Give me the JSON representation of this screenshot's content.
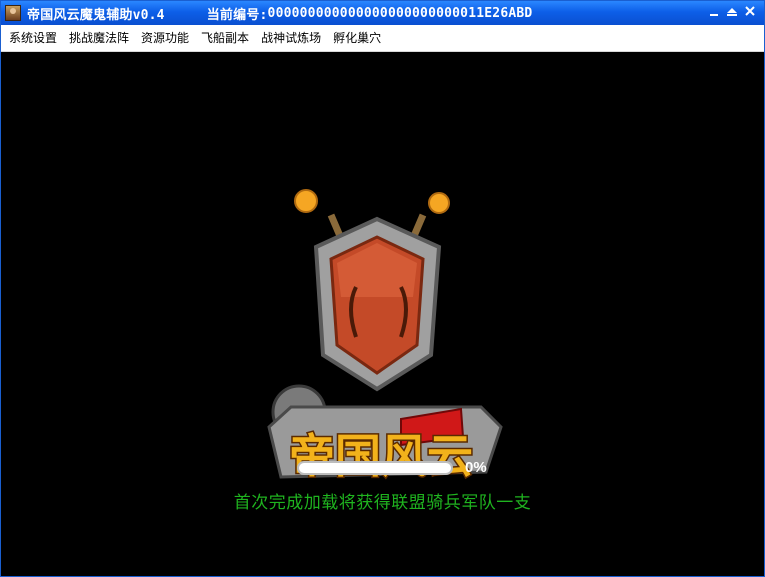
{
  "window": {
    "title": "帝国风云魔鬼辅助v0.4",
    "serial_label": "当前编号:",
    "serial_value": "000000000000000000000000011E26ABD",
    "buttons": {
      "minimize": "‗",
      "maximize": "⏶",
      "close": "✕"
    }
  },
  "menu": {
    "items": [
      "系统设置",
      "挑战魔法阵",
      "资源功能",
      "飞船副本",
      "战神试炼场",
      "孵化巢穴"
    ]
  },
  "loading": {
    "logo_text": "帝国风云",
    "progress": 0,
    "progress_label": "0%",
    "hint": "首次完成加载将获得联盟骑兵军队一支"
  },
  "colors": {
    "titlebar": "#0d5fe8",
    "hint": "#1fb31f",
    "logo_shield": "#c44a28",
    "logo_frame": "#9c9c9c"
  }
}
